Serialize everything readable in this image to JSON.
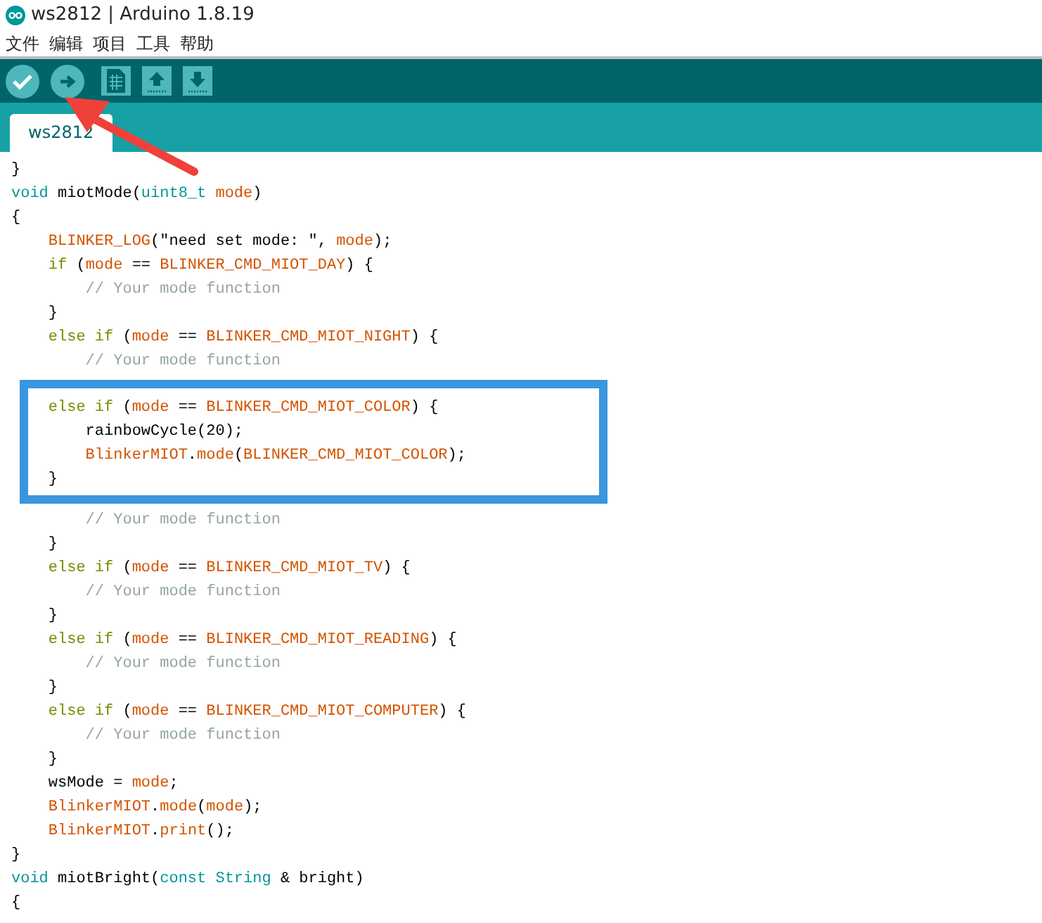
{
  "window": {
    "title": "ws2812 | Arduino 1.8.19"
  },
  "menu": [
    "文件",
    "编辑",
    "项目",
    "工具",
    "帮助"
  ],
  "toolbar": [
    {
      "kind": "round"
    },
    {
      "kind": "round"
    },
    {
      "kind": "square"
    },
    {
      "kind": "square"
    },
    {
      "kind": "square"
    }
  ],
  "tabs": [
    {
      "label": "ws2812",
      "selected": true
    }
  ],
  "code": {
    "lines_before": [
      [
        {
          "kind": "plain",
          "text": "}"
        }
      ],
      [
        {
          "kind": "type",
          "text": "void"
        },
        {
          "kind": "plain",
          "text": " miotMode("
        },
        {
          "kind": "type",
          "text": "uint8_t "
        },
        {
          "kind": "name",
          "text": "mode"
        },
        {
          "kind": "plain",
          "text": ")"
        }
      ],
      [
        {
          "kind": "plain",
          "text": "{"
        }
      ],
      [
        {
          "kind": "name",
          "text": "    BLINKER_LOG"
        },
        {
          "kind": "plain",
          "text": "(\"need set mode: \", "
        },
        {
          "kind": "name",
          "text": "mode"
        },
        {
          "kind": "plain",
          "text": ");"
        }
      ],
      [
        {
          "kind": "control",
          "text": "    if"
        },
        {
          "kind": "plain",
          "text": " ("
        },
        {
          "kind": "name",
          "text": "mode"
        },
        {
          "kind": "plain",
          "text": " == "
        },
        {
          "kind": "name",
          "text": "BLINKER_CMD_MIOT_DAY"
        },
        {
          "kind": "plain",
          "text": ") {"
        }
      ],
      [
        {
          "kind": "comment",
          "text": "        // Your mode function"
        }
      ],
      [
        {
          "kind": "plain",
          "text": "    }"
        }
      ],
      [
        {
          "kind": "control",
          "text": "    else if"
        },
        {
          "kind": "plain",
          "text": " ("
        },
        {
          "kind": "name",
          "text": "mode"
        },
        {
          "kind": "plain",
          "text": " == "
        },
        {
          "kind": "name",
          "text": "BLINKER_CMD_MIOT_NIGHT"
        },
        {
          "kind": "plain",
          "text": ") {"
        }
      ],
      [
        {
          "kind": "comment",
          "text": "        // Your mode function"
        }
      ]
    ],
    "highlighted_lines": [
      [
        {
          "kind": "control",
          "text": "    else if"
        },
        {
          "kind": "plain",
          "text": " ("
        },
        {
          "kind": "name",
          "text": "mode"
        },
        {
          "kind": "plain",
          "text": " == "
        },
        {
          "kind": "name",
          "text": "BLINKER_CMD_MIOT_COLOR"
        },
        {
          "kind": "plain",
          "text": ") {"
        }
      ],
      [
        {
          "kind": "plain",
          "text": "        rainbowCycle(20);"
        }
      ],
      [
        {
          "kind": "name",
          "text": "        BlinkerMIOT"
        },
        {
          "kind": "plain",
          "text": "."
        },
        {
          "kind": "name",
          "text": "mode"
        },
        {
          "kind": "plain",
          "text": "("
        },
        {
          "kind": "name",
          "text": "BLINKER_CMD_MIOT_COLOR"
        },
        {
          "kind": "plain",
          "text": ");"
        }
      ],
      [
        {
          "kind": "plain",
          "text": "    }"
        }
      ]
    ],
    "lines_after": [
      [
        {
          "kind": "comment",
          "text": "        // Your mode function"
        }
      ],
      [
        {
          "kind": "plain",
          "text": "    }"
        }
      ],
      [
        {
          "kind": "control",
          "text": "    else if"
        },
        {
          "kind": "plain",
          "text": " ("
        },
        {
          "kind": "name",
          "text": "mode"
        },
        {
          "kind": "plain",
          "text": " == "
        },
        {
          "kind": "name",
          "text": "BLINKER_CMD_MIOT_TV"
        },
        {
          "kind": "plain",
          "text": ") {"
        }
      ],
      [
        {
          "kind": "comment",
          "text": "        // Your mode function"
        }
      ],
      [
        {
          "kind": "plain",
          "text": "    }"
        }
      ],
      [
        {
          "kind": "control",
          "text": "    else if"
        },
        {
          "kind": "plain",
          "text": " ("
        },
        {
          "kind": "name",
          "text": "mode"
        },
        {
          "kind": "plain",
          "text": " == "
        },
        {
          "kind": "name",
          "text": "BLINKER_CMD_MIOT_READING"
        },
        {
          "kind": "plain",
          "text": ") {"
        }
      ],
      [
        {
          "kind": "comment",
          "text": "        // Your mode function"
        }
      ],
      [
        {
          "kind": "plain",
          "text": "    }"
        }
      ],
      [
        {
          "kind": "control",
          "text": "    else if"
        },
        {
          "kind": "plain",
          "text": " ("
        },
        {
          "kind": "name",
          "text": "mode"
        },
        {
          "kind": "plain",
          "text": " == "
        },
        {
          "kind": "name",
          "text": "BLINKER_CMD_MIOT_COMPUTER"
        },
        {
          "kind": "plain",
          "text": ") {"
        }
      ],
      [
        {
          "kind": "comment",
          "text": "        // Your mode function"
        }
      ],
      [
        {
          "kind": "plain",
          "text": "    }"
        }
      ],
      [
        {
          "kind": "plain",
          "text": "    wsMode = "
        },
        {
          "kind": "name",
          "text": "mode"
        },
        {
          "kind": "plain",
          "text": ";"
        }
      ],
      [
        {
          "kind": "name",
          "text": "    BlinkerMIOT"
        },
        {
          "kind": "plain",
          "text": "."
        },
        {
          "kind": "name",
          "text": "mode"
        },
        {
          "kind": "plain",
          "text": "("
        },
        {
          "kind": "name",
          "text": "mode"
        },
        {
          "kind": "plain",
          "text": ");"
        }
      ],
      [
        {
          "kind": "name",
          "text": "    BlinkerMIOT"
        },
        {
          "kind": "plain",
          "text": "."
        },
        {
          "kind": "name",
          "text": "print"
        },
        {
          "kind": "plain",
          "text": "();"
        }
      ],
      [
        {
          "kind": "plain",
          "text": "}"
        }
      ],
      [
        {
          "kind": "type",
          "text": "void"
        },
        {
          "kind": "plain",
          "text": " miotBright("
        },
        {
          "kind": "type",
          "text": "const String"
        },
        {
          "kind": "plain",
          "text": " & bright)"
        }
      ],
      [
        {
          "kind": "plain",
          "text": "{"
        }
      ]
    ]
  }
}
